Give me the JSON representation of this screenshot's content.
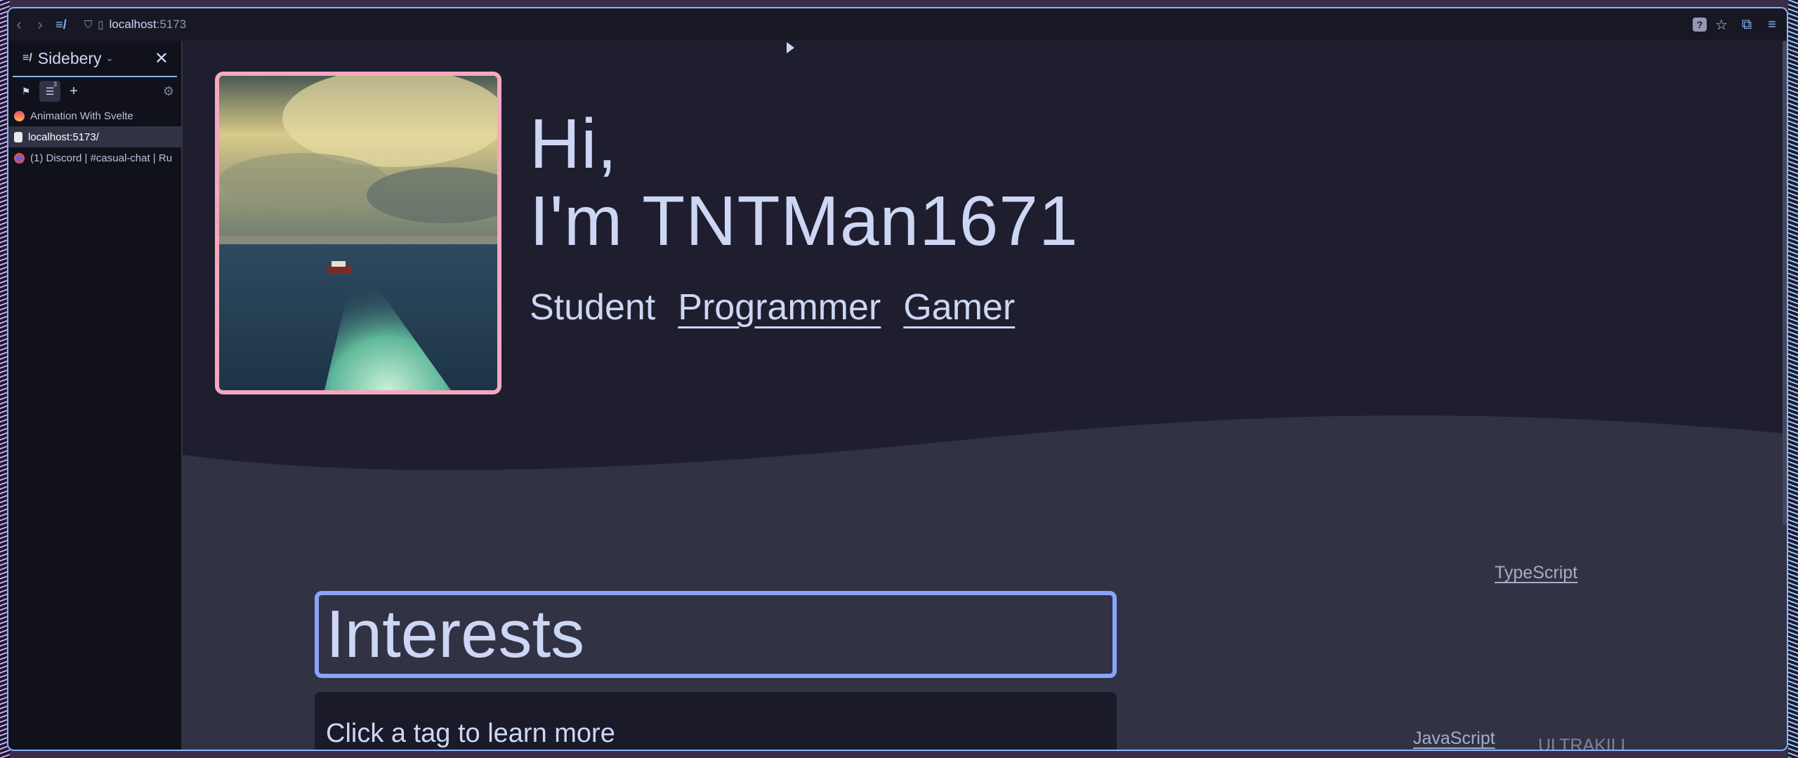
{
  "browser": {
    "url_host": "localhost",
    "url_port": ":5173",
    "icons": [
      "back-icon",
      "forward-icon",
      "sidebery-icon",
      "shield-icon",
      "page-icon",
      "help-icon",
      "star-icon",
      "extensions-icon",
      "menu-icon"
    ],
    "help_badge": "?"
  },
  "sidebar": {
    "title": "Sidebery",
    "panel_count": "3",
    "tabs": [
      {
        "label": "Animation With Svelte",
        "favicon": "svelte",
        "active": false
      },
      {
        "label": "localhost:5173/",
        "favicon": "page",
        "active": true
      },
      {
        "label": "(1) Discord | #casual-chat | Ru",
        "favicon": "discord",
        "active": false
      }
    ]
  },
  "page": {
    "greeting_line1": "Hi,",
    "greeting_line2": "I'm TNTMan1671",
    "roles": [
      "Student",
      "Programmer",
      "Gamer"
    ],
    "interests_heading": "Interests",
    "interests_hint": "Click a tag to learn more",
    "tags": [
      "TypeScript",
      "JavaScript",
      "ULTRAKILL"
    ]
  },
  "colors": {
    "window_border": "#89b4fa",
    "background": "#1e1e2e",
    "section_background": "#313244",
    "photo_border": "#f5a8bf",
    "text": "#cdd6f4"
  }
}
